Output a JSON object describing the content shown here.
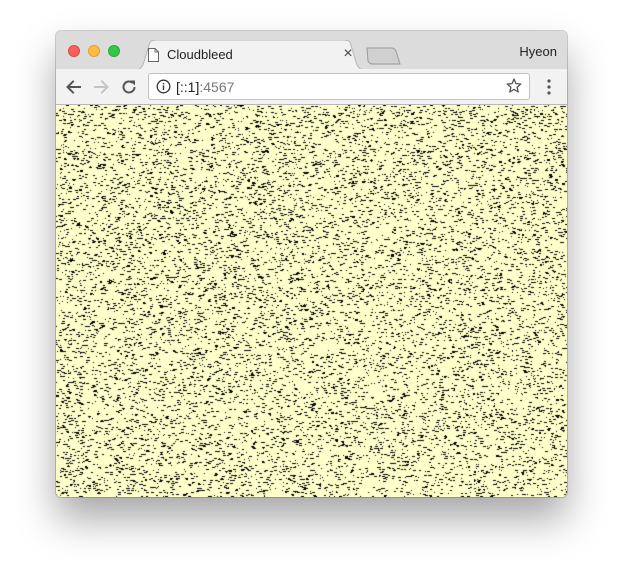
{
  "window": {
    "tab": {
      "title": "Cloudbleed",
      "close_glyph": "×",
      "icon": "page-icon"
    },
    "profile_name": "Hyeon"
  },
  "toolbar": {
    "back_icon": "back-arrow-icon",
    "forward_icon": "forward-arrow-icon",
    "reload_icon": "reload-icon",
    "address": {
      "host": "[::1]",
      "port": ":4567",
      "security_icon": "info-icon"
    },
    "bookmark_icon": "star-icon",
    "menu_icon": "kebab-menu-icon"
  },
  "page": {
    "background_color": "#ffffcc",
    "noise_color": "#000000"
  },
  "colors": {
    "traffic_close": "#fc605c",
    "traffic_minimize": "#fdbc40",
    "traffic_maximize": "#34c84a"
  }
}
